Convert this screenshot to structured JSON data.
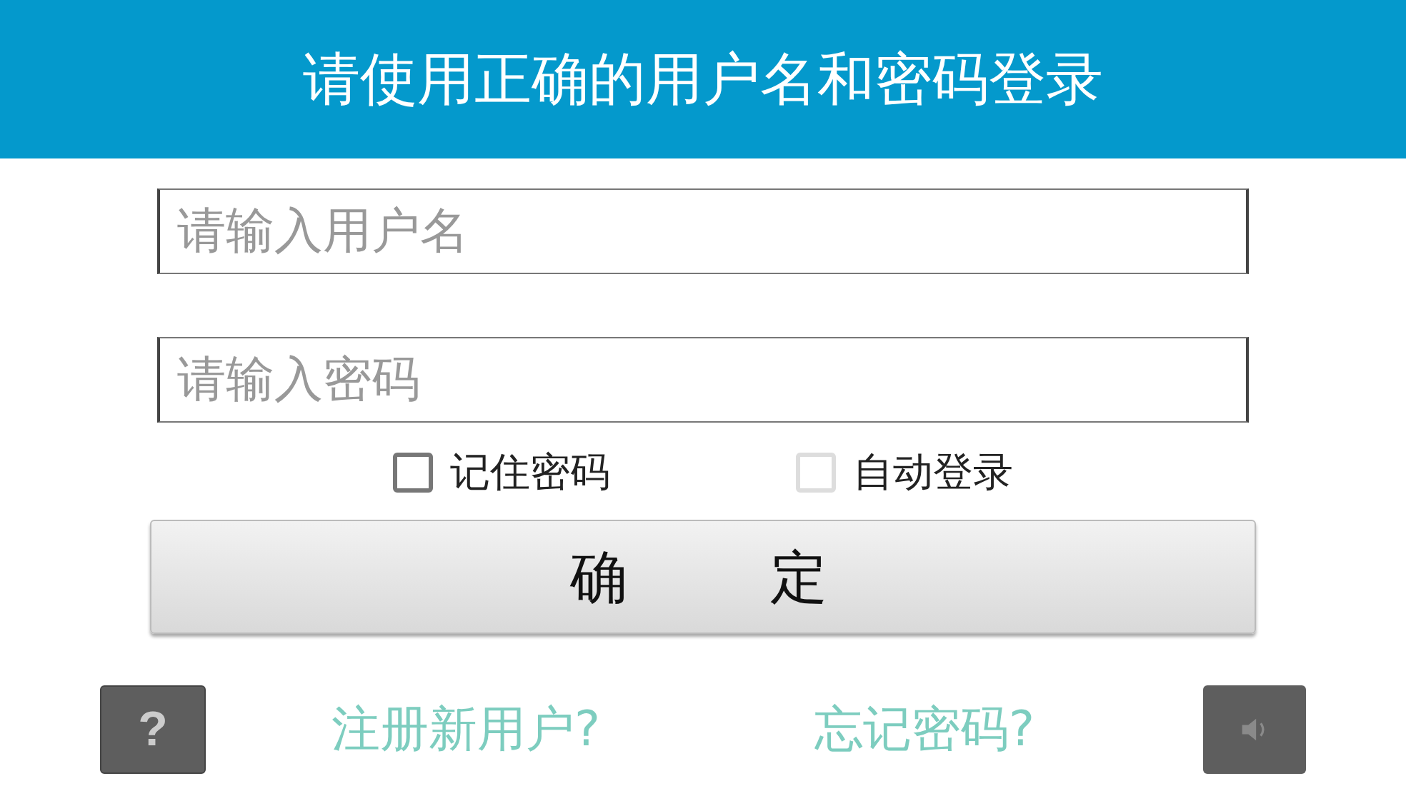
{
  "header": {
    "title": "请使用正确的用户名和密码登录"
  },
  "fields": [
    {
      "placeholder": "请输入用户名"
    },
    {
      "placeholder": "请输入密码"
    }
  ],
  "options": [
    {
      "label": "记住密码",
      "checked": false,
      "disabled": false
    },
    {
      "label": "自动登录",
      "checked": false,
      "disabled": true
    }
  ],
  "submit": {
    "label": "确定"
  },
  "footer": {
    "help": "?",
    "links": [
      "注册新用户?",
      "忘记密码?"
    ]
  }
}
